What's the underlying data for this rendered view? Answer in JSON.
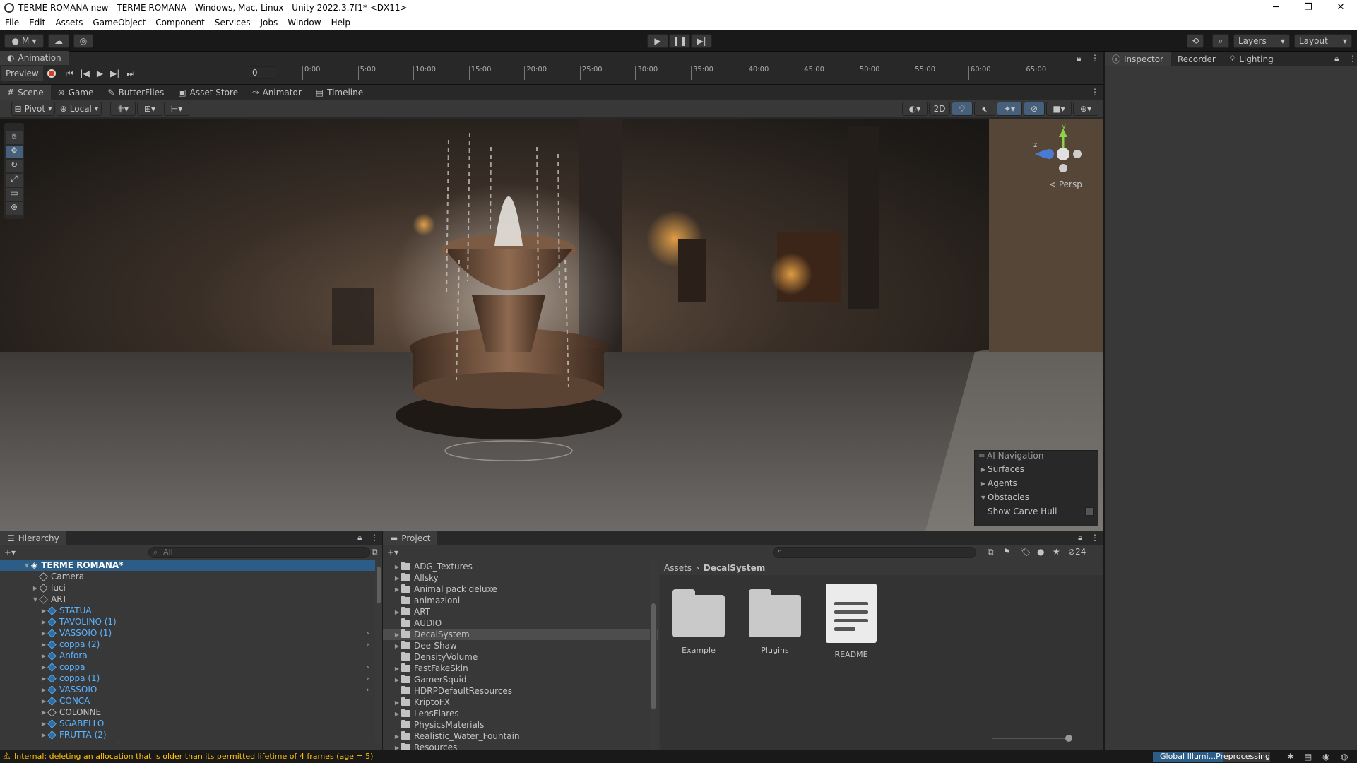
{
  "window": {
    "title": "TERME ROMANA-new - TERME ROMANA - Windows, Mac, Linux - Unity 2022.3.7f1* <DX11>"
  },
  "menu": [
    "File",
    "Edit",
    "Assets",
    "GameObject",
    "Component",
    "Services",
    "Jobs",
    "Window",
    "Help"
  ],
  "toolbar": {
    "account": "M",
    "layers": "Layers",
    "layout": "Layout"
  },
  "animation": {
    "tab": "Animation",
    "preview": "Preview",
    "frame": "0",
    "ticks": [
      "0:00",
      "5:00",
      "10:00",
      "15:00",
      "20:00",
      "25:00",
      "30:00",
      "35:00",
      "40:00",
      "45:00",
      "50:00",
      "55:00",
      "60:00",
      "65:00"
    ]
  },
  "inspector_tabs": [
    "Inspector",
    "Recorder",
    "Lighting"
  ],
  "scene": {
    "tabs": [
      "Scene",
      "Game",
      "ButterFlies",
      "Asset Store",
      "Animator",
      "Timeline"
    ],
    "pivot": "Pivot",
    "local": "Local",
    "mode2d": "2D",
    "persp": "< Persp",
    "gizmo_y": "y",
    "gizmo_z": "z",
    "ai_nav": {
      "title": "AI Navigation",
      "items": [
        "Surfaces",
        "Agents",
        "Obstacles"
      ],
      "show_carve_hull": "Show Carve Hull"
    }
  },
  "hierarchy": {
    "tab": "Hierarchy",
    "search_placeholder": "All",
    "root": "TERME ROMANA*",
    "items": [
      {
        "label": "Camera",
        "blue": false,
        "indent": 1,
        "arrow": ""
      },
      {
        "label": "luci",
        "blue": false,
        "indent": 1,
        "arrow": "▶"
      },
      {
        "label": "ART",
        "blue": false,
        "indent": 1,
        "arrow": "▼"
      },
      {
        "label": "STATUA",
        "blue": true,
        "indent": 2,
        "arrow": "▶"
      },
      {
        "label": "TAVOLINO (1)",
        "blue": true,
        "indent": 2,
        "arrow": "▶"
      },
      {
        "label": "VASSOIO (1)",
        "blue": true,
        "indent": 2,
        "arrow": "▶"
      },
      {
        "label": "coppa (2)",
        "blue": true,
        "indent": 2,
        "arrow": "▶"
      },
      {
        "label": "Anfora",
        "blue": true,
        "indent": 2,
        "arrow": "▶"
      },
      {
        "label": "coppa",
        "blue": true,
        "indent": 2,
        "arrow": "▶"
      },
      {
        "label": "coppa (1)",
        "blue": true,
        "indent": 2,
        "arrow": "▶"
      },
      {
        "label": "VASSOIO",
        "blue": true,
        "indent": 2,
        "arrow": "▶"
      },
      {
        "label": "CONCA",
        "blue": true,
        "indent": 2,
        "arrow": "▶"
      },
      {
        "label": "COLONNE",
        "blue": false,
        "indent": 2,
        "arrow": "▶"
      },
      {
        "label": "SGABELLO",
        "blue": true,
        "indent": 2,
        "arrow": "▶"
      },
      {
        "label": "FRUTTA (2)",
        "blue": true,
        "indent": 2,
        "arrow": "▶"
      },
      {
        "label": "Water_Fountain",
        "blue": true,
        "indent": 2,
        "arrow": "▶"
      }
    ]
  },
  "project": {
    "tab": "Project",
    "hidden_count": "24",
    "folders": [
      "ADG_Textures",
      "Allsky",
      "Animal pack deluxe",
      "animazioni",
      "ART",
      "AUDIO",
      "DecalSystem",
      "Dee-Shaw",
      "DensityVolume",
      "FastFakeSkin",
      "GamerSquid",
      "HDRPDefaultResources",
      "KriptoFX",
      "LensFlares",
      "PhysicsMaterials",
      "Realistic_Water_Fountain",
      "Resources"
    ],
    "selected_folder": "DecalSystem",
    "breadcrumb": [
      "Assets",
      "DecalSystem"
    ],
    "assets": [
      "Example",
      "Plugins",
      "README"
    ]
  },
  "status": {
    "message": "Internal: deleting an allocation that is older than its permitted lifetime of 4 frames (age = 5)",
    "progress_label": "Global Illumi...Preprocessing"
  }
}
